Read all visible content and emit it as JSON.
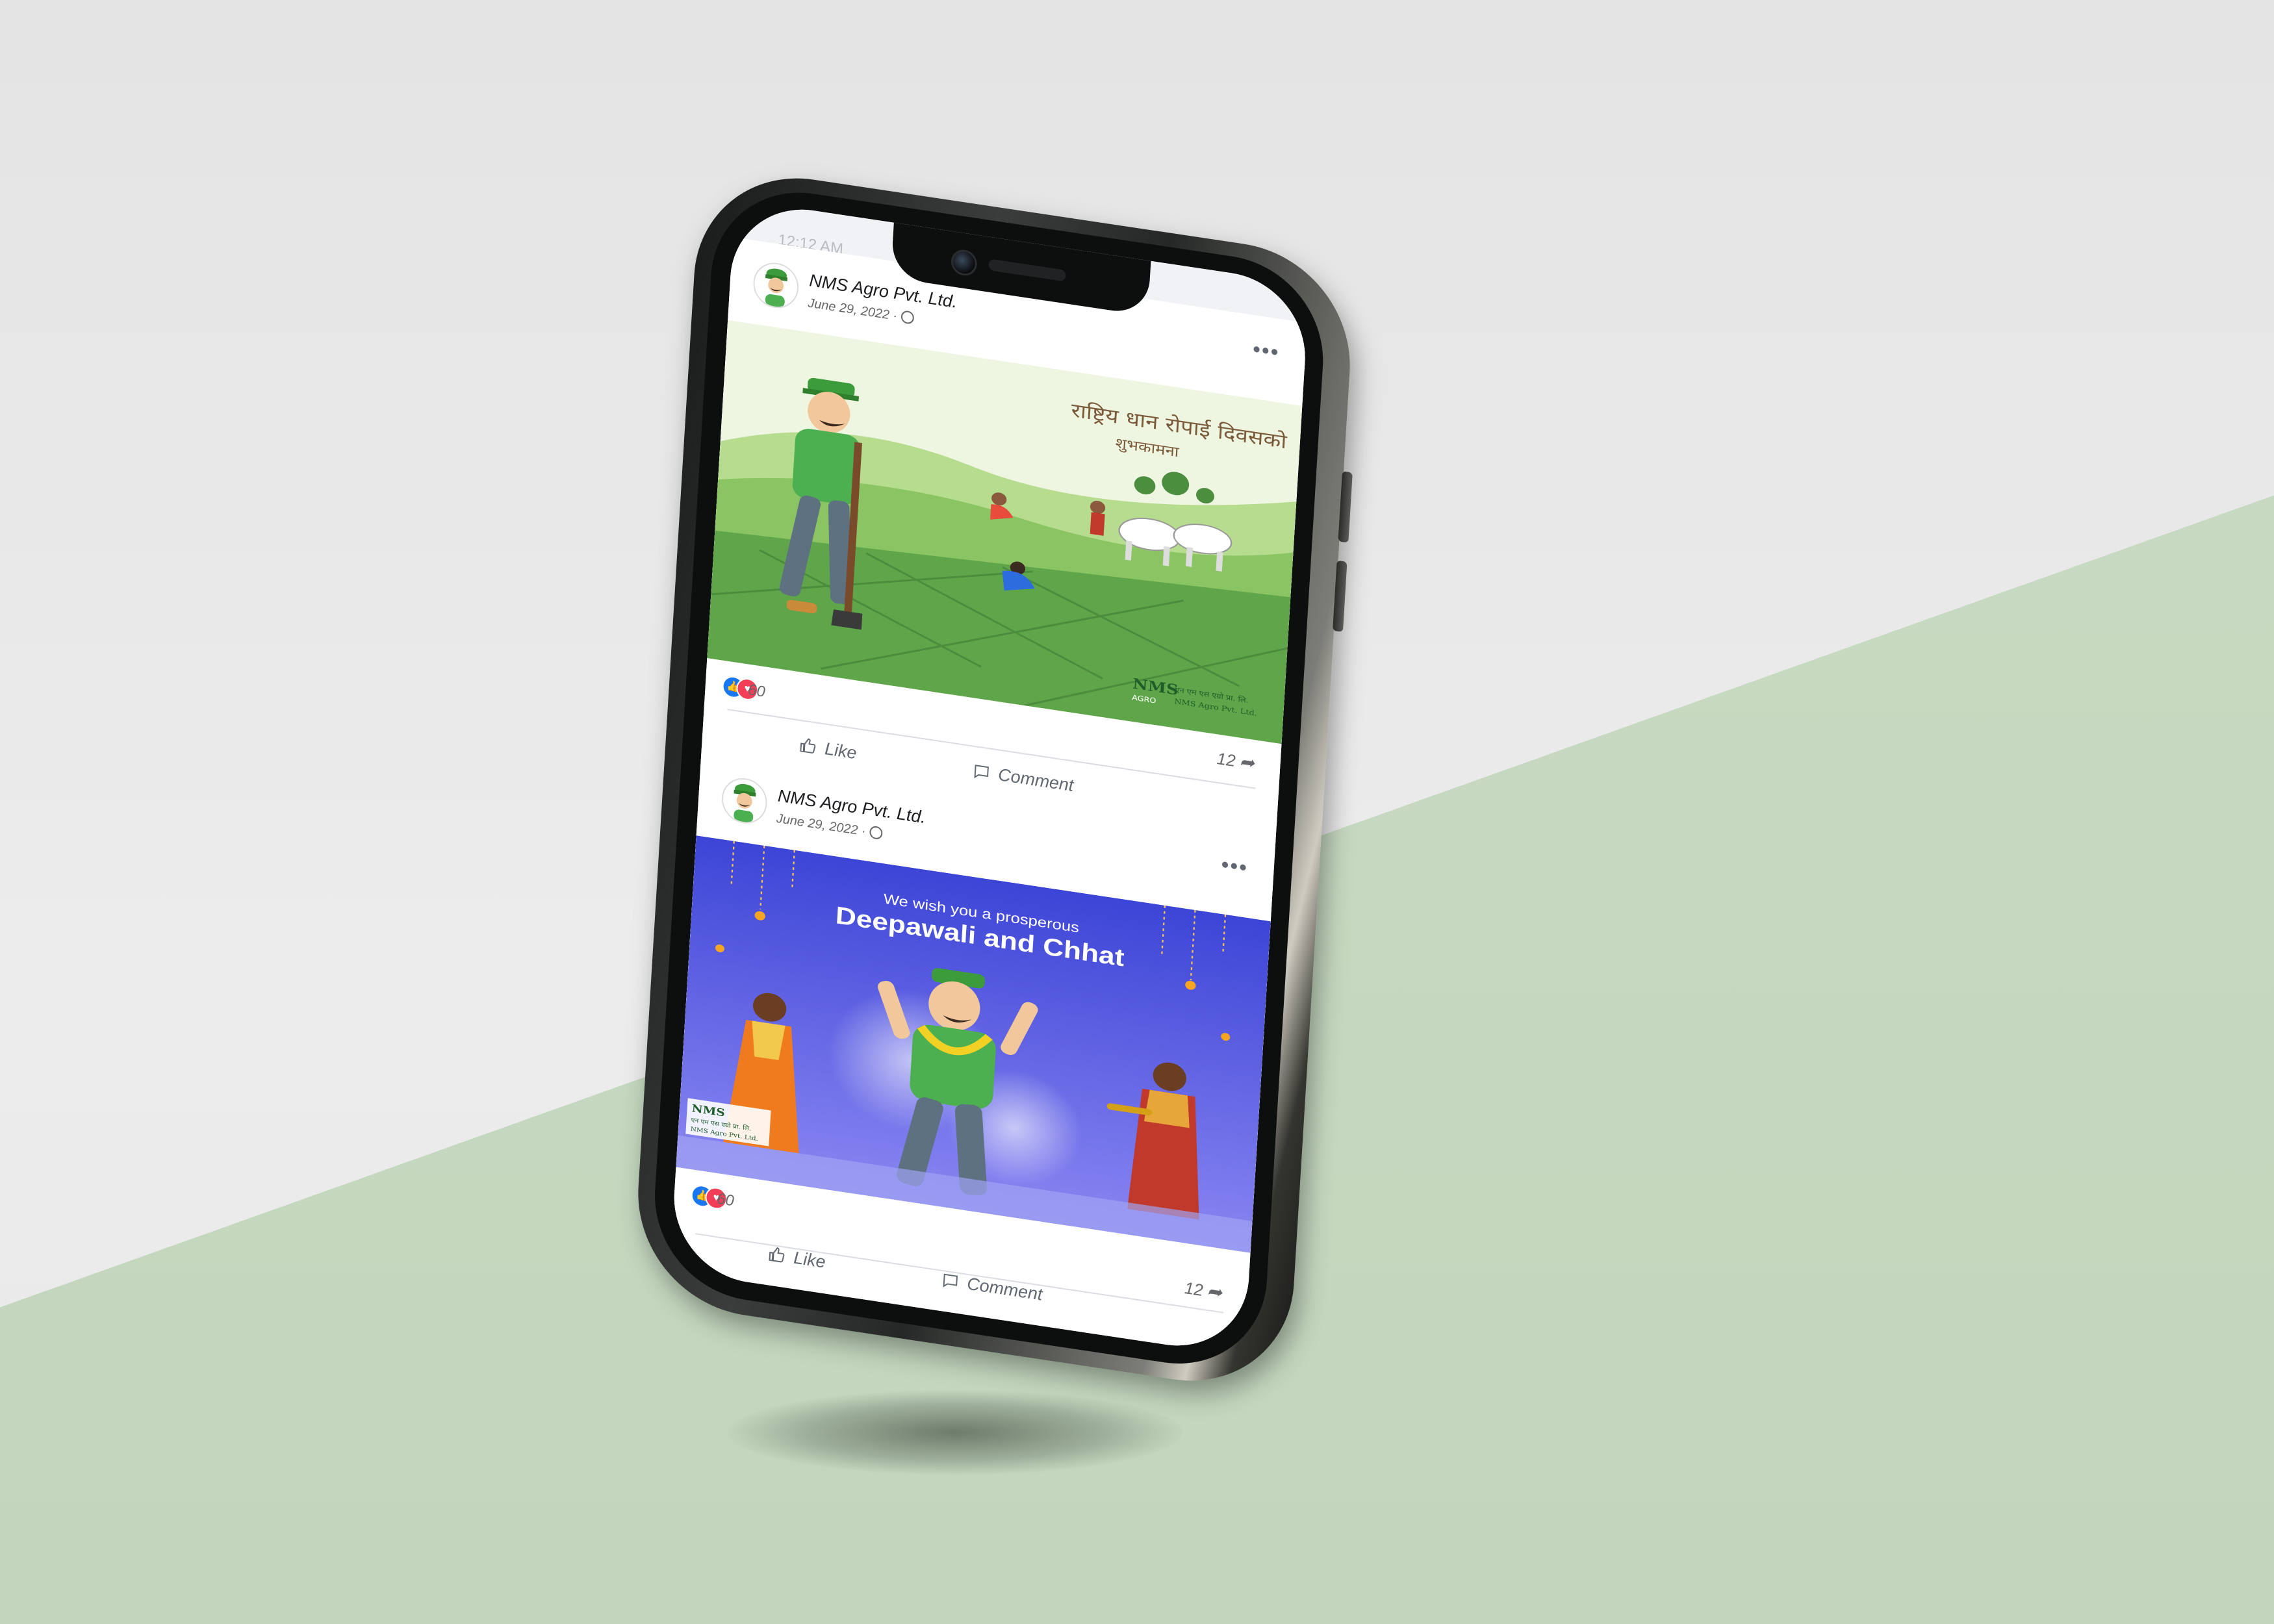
{
  "status_bar": {
    "time": "12:12 AM"
  },
  "posts": [
    {
      "author": "NMS Agro Pvt. Ltd.",
      "date": "June 29, 2022 ·",
      "image": {
        "theme": "paddy-plantation",
        "heading_line1": "राष्ट्रिय धान रोपाई दिवसको",
        "heading_line2": "शुभकामना",
        "logo_text": "NMS",
        "logo_sub": "AGRO",
        "logo_caption_line1": "एन एम एस एग्रो प्रा. लि.",
        "logo_caption_line2": "NMS Agro Pvt. Ltd.",
        "colors": {
          "sky": "#eef5e0",
          "hill": "#8bc463",
          "field": "#5fa64a"
        }
      },
      "reaction_count": "60",
      "share_count": "12",
      "actions": {
        "like": "Like",
        "comment": "Comment"
      }
    },
    {
      "author": "NMS Agro Pvt. Ltd.",
      "date": "June 29, 2022 ·",
      "image": {
        "theme": "festival-greeting",
        "heading_line1": "We wish you a prosperous",
        "heading_line2": "Deepawali and Chhat",
        "logo_text": "NMS",
        "logo_caption_line1": "एन एम एस एग्रो प्रा. लि.",
        "logo_caption_line2": "NMS Agro Pvt. Ltd.",
        "colors": {
          "bg_top": "#3c45d6",
          "bg_bottom": "#7e7ef0"
        }
      },
      "reaction_count": "60",
      "share_count": "12",
      "actions": {
        "like": "Like",
        "comment": "Comment"
      }
    }
  ],
  "icons": [
    "like-reaction-icon",
    "love-reaction-icon",
    "share-icon",
    "like-icon",
    "comment-icon",
    "globe-icon",
    "more-options-icon"
  ],
  "colors": {
    "accent": "#1877f2",
    "love": "#f33e58",
    "text_muted": "#65676b"
  }
}
